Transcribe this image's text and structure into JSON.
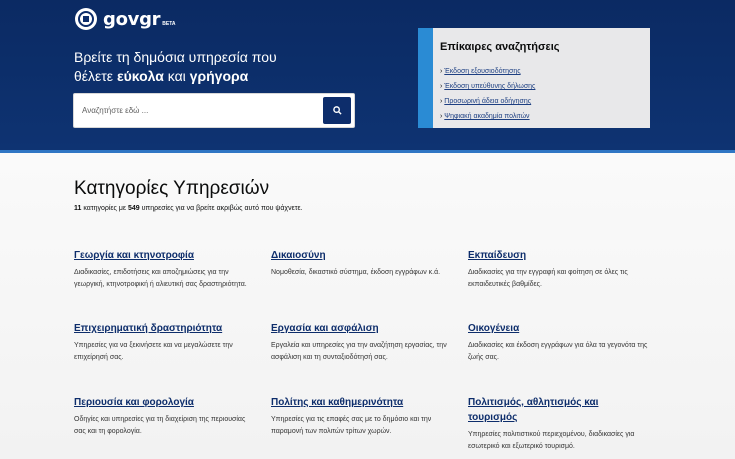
{
  "logo": {
    "gov": "gov",
    "gr": "gr",
    "beta": "BETA"
  },
  "hero": {
    "line1": "Βρείτε τη δημόσια υπηρεσία που",
    "line2_pre": "θέλετε ",
    "line2_b1": "εύκολα",
    "line2_mid": " και ",
    "line2_b2": "γρήγορα"
  },
  "search": {
    "placeholder": "Αναζητήστε εδώ ..."
  },
  "popular": {
    "title": "Επίκαιρες αναζητήσεις",
    "items": [
      "Έκδοση εξουσιοδότησης",
      "Έκδοση υπεύθυνης δήλωσης",
      "Προσωρινή άδεια οδήγησης",
      "Ψηφιακή ακαδημία πολιτών"
    ]
  },
  "categories": {
    "title": "Κατηγορίες Υπηρεσιών",
    "count": "11",
    "sub_mid": " κατηγορίες με ",
    "services": "549",
    "sub_end": " υπηρεσίες για να βρείτε ακριβώς αυτό που ψάχνετε.",
    "items": [
      {
        "title": "Γεωργία και κτηνοτροφία",
        "desc": "Διαδικασίες, επιδοτήσεις και αποζημιώσεις για την γεωργική, κτηνοτροφική ή αλιευτική σας δραστηριότητα."
      },
      {
        "title": "Δικαιοσύνη",
        "desc": "Νομοθεσία, δικαστικό σύστημα, έκδοση εγγράφων κ.ά."
      },
      {
        "title": "Εκπαίδευση",
        "desc": "Διαδικασίες για την εγγραφή και φοίτηση σε όλες τις εκπαιδευτικές βαθμίδες."
      },
      {
        "title": "Επιχειρηματική δραστηριότητα",
        "desc": "Υπηρεσίες για να ξεκινήσετε και να μεγαλώσετε την επιχείρησή σας."
      },
      {
        "title": "Εργασία και ασφάλιση",
        "desc": "Εργαλεία και υπηρεσίες για την αναζήτηση εργασίας, την ασφάλιση και τη συνταξιοδότησή σας."
      },
      {
        "title": "Οικογένεια",
        "desc": "Διαδικασίες και έκδοση εγγράφων για όλα τα γεγονότα της ζωής σας."
      },
      {
        "title": "Περιουσία και φορολογία",
        "desc": "Οδηγίες και υπηρεσίες για τη διαχείριση της περιουσίας σας και τη φορολογία."
      },
      {
        "title": "Πολίτης και καθημερινότητα",
        "desc": "Υπηρεσίες για τις επαφές σας με το δημόσιο και την παραμονή των πολιτών τρίτων χωρών."
      },
      {
        "title": "Πολιτισμός, αθλητισμός και τουρισμός",
        "desc": "Υπηρεσίες πολιτιστικού περιεχομένου, διαδικασίες για εσωτερικό και εξωτερικό τουρισμό."
      }
    ]
  },
  "colors": {
    "primary": "#0d2d6b",
    "accent": "#2a8bd4",
    "link": "#1d3f82"
  },
  "icons": {
    "search": "search-icon",
    "emblem": "greek-emblem-icon"
  }
}
